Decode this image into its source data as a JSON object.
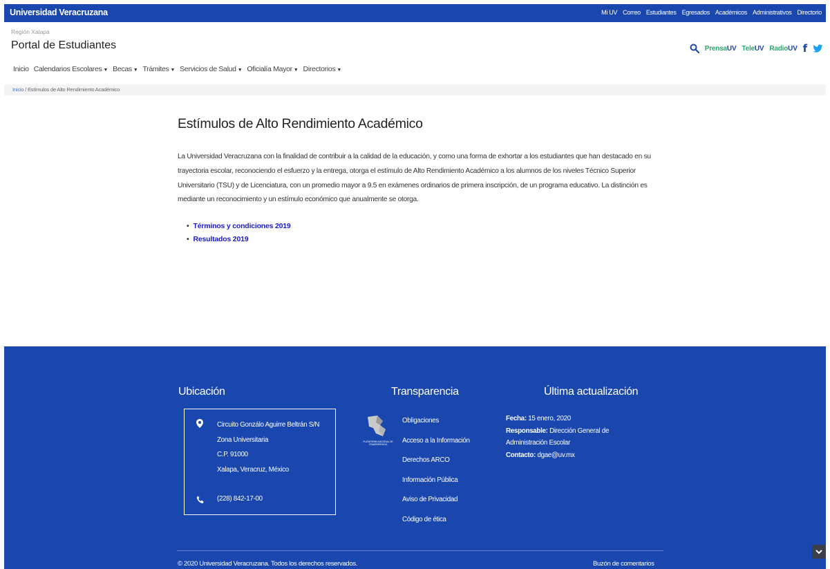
{
  "topbar": {
    "brand": "Universidad Veracruzana",
    "links": [
      "Mi UV",
      "Correo",
      "Estudiantes",
      "Egresados",
      "Académicos",
      "Administrativos",
      "Directorio"
    ]
  },
  "header": {
    "region": "Región Xalapa",
    "title": "Portal de Estudiantes",
    "social": {
      "prensa_a": "Prensa",
      "prensa_b": "UV",
      "tele_a": "Tele",
      "tele_b": "UV",
      "radio_a": "Radio",
      "radio_b": "UV",
      "facebook": "f"
    }
  },
  "nav": {
    "items": [
      {
        "label": "Inicio",
        "dropdown": false
      },
      {
        "label": "Calendarios Escolares",
        "dropdown": true
      },
      {
        "label": "Becas",
        "dropdown": true
      },
      {
        "label": "Trámites",
        "dropdown": true
      },
      {
        "label": "Servicios de Salud",
        "dropdown": true
      },
      {
        "label": "Oficialía Mayor",
        "dropdown": true
      },
      {
        "label": "Directorios",
        "dropdown": true
      }
    ],
    "caret": "▼"
  },
  "breadcrumb": {
    "home": "Inicio",
    "separator": " / ",
    "current": "Estímulos de Alto Rendimiento Académico"
  },
  "main": {
    "title": "Estímulos de Alto Rendimiento Académico",
    "intro": "La Universidad Veracruzana con la finalidad de contribuir a la calidad de la educación, y como una forma de exhortar a los estudiantes que han destacado en su trayectoria escolar, reconociendo el esfuerzo y la entrega, otorga el estímulo de Alto Rendimiento Académico a los alumnos de los niveles Técnico Superior Universitario (TSU) y de Licenciatura, con un promedio mayor a 9.5 en exámenes ordinarios de primera inscripción, de un programa educativo. La distinción es mediante un reconocimiento y un estímulo económico que anualmente se otorga.",
    "links": [
      "Términos y condiciones 2019",
      "Resultados 2019"
    ]
  },
  "footer": {
    "ubicacion": {
      "title": "Ubicación",
      "address": [
        "Circuito Gonzálo Aguirre Beltrán S/N",
        "Zona Universitaria",
        "C.P. 91000",
        "Xalapa, Veracruz, México"
      ],
      "phone": "(228) 842-17-00"
    },
    "transparencia": {
      "title": "Transparencia",
      "logo_caption": "PLATAFORMA NACIONAL DE TRANSPARENCIA",
      "links": [
        "Obligaciones",
        "Acceso a la Información",
        "Derechos ARCO",
        "Información Pública",
        "Aviso de Privacidad",
        "Código de ética"
      ]
    },
    "ultima": {
      "title": "Última actualización",
      "fecha_label": "Fecha:",
      "fecha": " 15 enero, 2020",
      "responsable_label": "Responsable:",
      "responsable": " Dirección General de Administración Escolar",
      "contacto_label": "Contacto:",
      "contacto": " dgae@uv.mx"
    },
    "copyright": "© 2020 Universidad Veracruzana. Todos los derechos reservados.",
    "buzon": "Buzón de comentarios"
  },
  "colors": {
    "brand_blue": "#1a47ae",
    "link_blue": "#1a1ad6",
    "accent_green": "#2aa86d"
  }
}
